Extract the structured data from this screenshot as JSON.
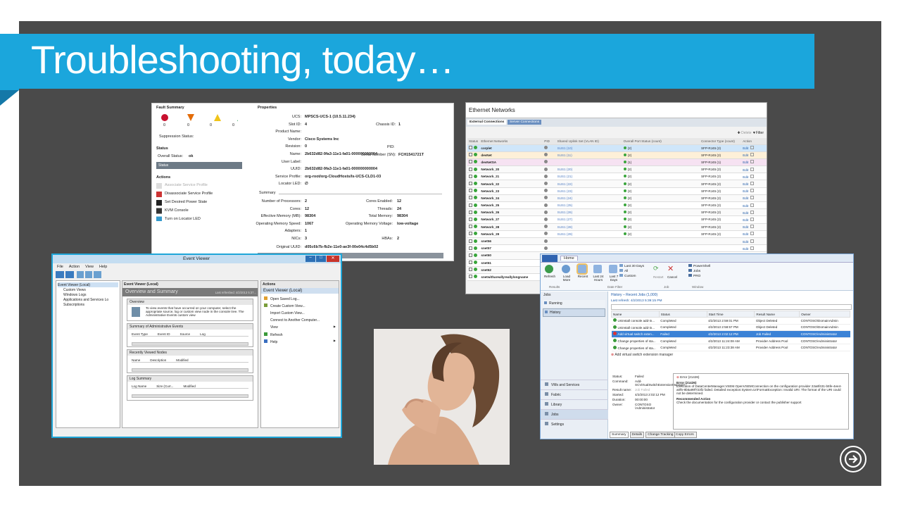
{
  "slide": {
    "title": "Troubleshooting, today…"
  },
  "ucs": {
    "fault_title": "Fault Summary",
    "fault_counts": [
      "0",
      "0",
      "0",
      "0"
    ],
    "suppression": "Suppression Status:",
    "status_title": "Status",
    "overall_status_label": "Overall Status:",
    "overall_status_value": "ok",
    "status_bar": "Status",
    "actions_title": "Actions",
    "actions": [
      "Associate Service Profile",
      "Disassociate Service Profile",
      "Set Desired Power State",
      "KVM Console",
      "Turn on Locator LED"
    ],
    "properties_title": "Properties",
    "props": [
      {
        "k": "UCS:",
        "v": "MPSCS-UCS-1 (10.5.11.234)"
      },
      {
        "k": "Slot ID:",
        "v": "4"
      },
      {
        "k": "Product Name:",
        "v": ""
      },
      {
        "k": "Vendor:",
        "v": "Cisco Systems Inc"
      },
      {
        "k": "Revision:",
        "v": "0"
      },
      {
        "k": "Name:",
        "v": "2b632d82-9fa3-11e1-fa01-000000000004"
      },
      {
        "k": "User Label:",
        "v": ""
      },
      {
        "k": "UUID:",
        "v": "2b632d82-9fa3-11e1-fa01-000000000004"
      },
      {
        "k": "Service Profile:",
        "v": "org-root/org-CloudHosts/ls-UCS-CLD1-03"
      },
      {
        "k": "Locator LED:",
        "v": "∅"
      }
    ],
    "chassis_label": "Chassis ID:",
    "chassis_value": "1",
    "pid_label": "PID:",
    "serial_label": "Serial Number (SN):",
    "serial_value": "FCH1541721T",
    "summary_title": "Summary",
    "summary_left": [
      {
        "k": "Number of Processors:",
        "v": "2"
      },
      {
        "k": "Cores:",
        "v": "12"
      },
      {
        "k": "Effective Memory (MB):",
        "v": "98304"
      },
      {
        "k": "Operating Memory Speed:",
        "v": "1067"
      },
      {
        "k": "Adapters:",
        "v": "1"
      },
      {
        "k": "NICs:",
        "v": "3"
      },
      {
        "k": "Original UUID:",
        "v": "d05c6b7b-fb2e-11e0-ae3f-00e04c4d5b02"
      }
    ],
    "summary_right": [
      {
        "k": "Cores Enabled:",
        "v": "12"
      },
      {
        "k": "Threads:",
        "v": "24"
      },
      {
        "k": "Total Memory:",
        "v": "98304"
      },
      {
        "k": "Operating Memory Voltage:",
        "v": "low-voltage"
      },
      {
        "k": "HBAs:",
        "v": "2"
      }
    ]
  },
  "eth": {
    "title": "Ethernet Networks",
    "tabs": [
      "External Connections",
      "Server Connections"
    ],
    "toolbar": [
      "Delete",
      "Filter"
    ],
    "columns": [
      "Status",
      "Ethernet Networks",
      "PID",
      "Shared Uplink Set (VLAN ID)",
      "Overall Port Status (count)",
      "Connector Type (count)",
      "Action"
    ],
    "rows": [
      {
        "n": "corplet",
        "u": "SUS1 (10)",
        "p": "(2)",
        "c": "SFP-RJ45 (2)"
      },
      {
        "n": "devNet",
        "u": "SUS1 (11)",
        "p": "(2)",
        "c": "SFP-RJ45 (2)"
      },
      {
        "n": "devNetSA",
        "u": "",
        "p": "(1)",
        "c": "SFP-RJ45 (1)"
      },
      {
        "n": "Network_20",
        "u": "SUS1 (20)",
        "p": "(2)",
        "c": "SFP-RJ45 (2)"
      },
      {
        "n": "Network_21",
        "u": "SUS1 (21)",
        "p": "(2)",
        "c": "SFP-RJ45 (2)"
      },
      {
        "n": "Network_22",
        "u": "SUS1 (22)",
        "p": "(2)",
        "c": "SFP-RJ45 (2)"
      },
      {
        "n": "Network_23",
        "u": "SUS1 (23)",
        "p": "(2)",
        "c": "SFP-RJ45 (2)"
      },
      {
        "n": "Network_24",
        "u": "SUS1 (24)",
        "p": "(2)",
        "c": "SFP-RJ45 (2)"
      },
      {
        "n": "Network_25",
        "u": "SUS1 (25)",
        "p": "(2)",
        "c": "SFP-RJ45 (2)"
      },
      {
        "n": "Network_26",
        "u": "SUS1 (26)",
        "p": "(2)",
        "c": "SFP-RJ45 (2)"
      },
      {
        "n": "Network_27",
        "u": "SUS1 (27)",
        "p": "(2)",
        "c": "SFP-RJ45 (2)"
      },
      {
        "n": "Network_28",
        "u": "SUS1 (28)",
        "p": "(2)",
        "c": "SFP-RJ45 (2)"
      },
      {
        "n": "Network_29",
        "u": "SUS1 (29)",
        "p": "(2)",
        "c": "SFP-RJ45 (2)"
      },
      {
        "n": "snet56",
        "u": "",
        "p": "",
        "c": ""
      },
      {
        "n": "snet57",
        "u": "",
        "p": "",
        "c": ""
      },
      {
        "n": "snet60",
        "u": "",
        "p": "",
        "c": ""
      },
      {
        "n": "snet61",
        "u": "",
        "p": "",
        "c": ""
      },
      {
        "n": "snet62",
        "u": "",
        "p": "",
        "c": ""
      },
      {
        "n": "snetwithareallyreallylongname",
        "u": "",
        "p": "",
        "c": ""
      }
    ],
    "edit": "Edit"
  },
  "ev": {
    "title": "Event Viewer",
    "menu": [
      "File",
      "Action",
      "View",
      "Help"
    ],
    "tree": [
      "Event Viewer (Local)",
      "Custom Views",
      "Windows Logs",
      "Applications and Services Lo",
      "Subscriptions"
    ],
    "center_head": "Event Viewer (Local)",
    "banner": "Overview and Summary",
    "refreshed": "Last refreshed: 4/2/2013 5:37...",
    "overview": "Overview",
    "overview_text": "To view events that have occurred on your computer, select the appropriate source, log or custom view node in the console tree. The Administrative Events custom view",
    "sec_admin": "Summary of Administrative Events",
    "admin_cols": [
      "Event Type",
      "Event ID",
      "Source",
      "Log"
    ],
    "sec_recent": "Recently Viewed Nodes",
    "recent_cols": [
      "Name",
      "Description",
      "Modified"
    ],
    "sec_log": "Log Summary",
    "log_cols": [
      "Log Name",
      "Size (Curr...",
      "Modified"
    ],
    "actions_head": "Actions",
    "actions_sub": "Event Viewer (Local)",
    "actions": [
      "Open Saved Log...",
      "Create Custom View...",
      "Import Custom View...",
      "Connect to Another Computer...",
      "View",
      "Refresh",
      "Help"
    ]
  },
  "vmm": {
    "tab": "Home",
    "ribbon": [
      {
        "label": "Refresh",
        "group": "Results"
      },
      {
        "label": "Load More",
        "group": ""
      },
      {
        "label": "Recent",
        "group": "Date Filter"
      },
      {
        "label": "Last 24 Hours",
        "group": ""
      },
      {
        "label": "Last 7 Days",
        "group": ""
      }
    ],
    "date_list": [
      "Last 30 Days",
      "All",
      "Custom"
    ],
    "job_btns": [
      "Restart",
      "Cancel"
    ],
    "window_list": [
      "PowerShell",
      "Jobs",
      "PRO"
    ],
    "groups": [
      "Results",
      "Date Filter",
      "Job",
      "Window"
    ],
    "nav_head": "Jobs",
    "nav_items": [
      "Running",
      "History"
    ],
    "nav_bottom": [
      "VMs and Services",
      "Fabric",
      "Library",
      "Jobs",
      "Settings"
    ],
    "crumb": "History – Recent Jobs (1,000)",
    "refresh": "Last refresh: 4/2/2013 5:39:15 PM",
    "cols": [
      "Name",
      "Status",
      "Start Time",
      "Result Name",
      "Owner"
    ],
    "rows": [
      {
        "name": "Uninstall console add-in...",
        "status": "Completed",
        "start": "4/2/2013 2:59:01 PM",
        "result": "Object Deleted",
        "owner": "CONTOSO\\DomainAdmin",
        "err": false
      },
      {
        "name": "Uninstall console add-in...",
        "status": "Completed",
        "start": "4/2/2013 2:58:57 PM",
        "result": "Object Deleted",
        "owner": "CONTOSO\\DomainAdmin",
        "err": false
      },
      {
        "name": "Add virtual switch exten...",
        "status": "Failed",
        "start": "4/2/2013 2:02:12 PM",
        "result": "Job Failed",
        "owner": "CONTOSO\\Administrator",
        "err": true
      },
      {
        "name": "Change properties of sta...",
        "status": "Completed",
        "start": "4/2/2013 11:24:08 AM",
        "result": "Provider Address Pool",
        "owner": "CONTOSO\\Administrator",
        "err": false
      },
      {
        "name": "Change properties of sta...",
        "status": "Completed",
        "start": "4/2/2013 11:23:38 AM",
        "result": "Provider Address Pool",
        "owner": "CONTOSO\\Administrator",
        "err": false
      }
    ],
    "detail_title": "Add virtual switch extension manager",
    "detail": [
      {
        "k": "Status:",
        "v": "Failed"
      },
      {
        "k": "Command:",
        "v": "Add-SCVirtualSwitchExtensionManager"
      },
      {
        "k": "Result name:",
        "v": "Job Failed"
      },
      {
        "k": "Started:",
        "v": "4/2/2013 2:02:12 PM"
      },
      {
        "k": "Duration:",
        "v": "00:00:00"
      },
      {
        "k": "Owner:",
        "v": "CONTOSO \\Administrator"
      }
    ],
    "err_head": "Error (21426)",
    "err_bold": "Error (21426)",
    "err_text": "Execution of DataCenterManager.VSEM.OpenVSEMConnection on the configuration provider 22a8f431-b5fe-4ee4-a0f5-9b5a99f723f2 failed. Detailed exception:System.UriFormatException: Invalid URI: The format of the URI could not be determined.",
    "rec_head": "Recommended Action",
    "rec_text": "Check the documentation for the configuration provider or contact the publisher support",
    "copy": "Copy Errors",
    "bottom_tabs": [
      "Summary",
      "Details",
      "Change Tracking"
    ]
  }
}
